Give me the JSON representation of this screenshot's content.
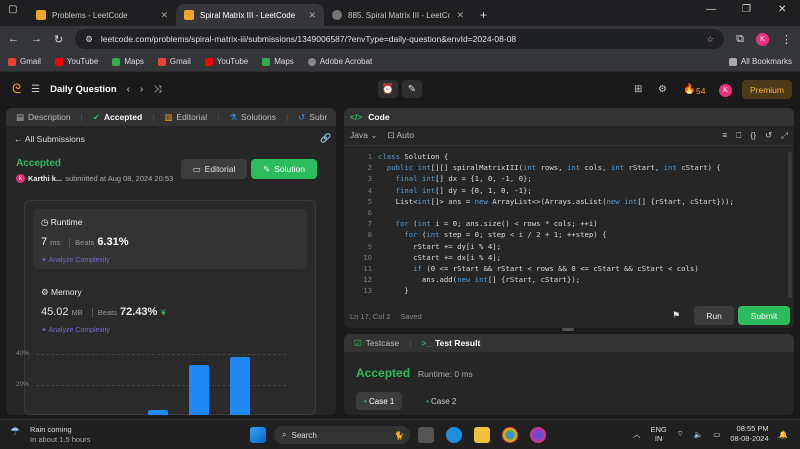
{
  "browser": {
    "tabs": [
      {
        "title": "Problems - LeetCode",
        "active": false
      },
      {
        "title": "Spiral Matrix III - LeetCode",
        "active": true
      },
      {
        "title": "885. Spiral Matrix III - LeetCod",
        "active": false
      }
    ],
    "new_tab": "+",
    "url": "leetcode.com/problems/spiral-matrix-iii/submissions/1349006587/?envType=daily-question&envId=2024-08-08",
    "profile_initial": "K",
    "bookmarks": [
      "Gmail",
      "YouTube",
      "Maps",
      "Gmail",
      "YouTube",
      "Maps",
      "Adobe Acrobat"
    ],
    "all_bookmarks": "All Bookmarks"
  },
  "lc_nav": {
    "title": "Daily Question",
    "streak": "54",
    "avatar": "K",
    "premium": "Premium"
  },
  "left_panel": {
    "tabs": [
      "Description",
      "Accepted",
      "Editorial",
      "Solutions",
      "Subr"
    ],
    "all_submissions": "All Submissions",
    "status": "Accepted",
    "user": "Karthi k...",
    "submitted": "submitted at Aug 08, 2024 20:53",
    "editorial_btn": "Editorial",
    "solution_btn": "Solution",
    "runtime": {
      "label": "Runtime",
      "value": "7",
      "unit": "ms",
      "beats_label": "Beats",
      "beats": "6.31%",
      "analyze": "Analyze Complexity"
    },
    "memory": {
      "label": "Memory",
      "value": "45.02",
      "unit": "MB",
      "beats_label": "Beats",
      "beats": "72.43%",
      "analyze": "Analyze Complexity"
    }
  },
  "chart_data": {
    "type": "bar",
    "yticks": [
      "40%",
      "20%"
    ],
    "ylim": [
      0,
      45
    ],
    "values": [
      4,
      33,
      38
    ]
  },
  "code_panel": {
    "title": "Code",
    "language": "Java",
    "mode": "Auto",
    "lines": [
      "class Solution {",
      "  public int[][] spiralMatrixIII(int rows, int cols, int rStart, int cStart) {",
      "    final int[] dx = {1, 0, -1, 0};",
      "    final int[] dy = {0, 1, 0, -1};",
      "    List<int[]> ans = new ArrayList<>(Arrays.asList(new int[] {rStart, cStart}));",
      "",
      "    for (int i = 0; ans.size() < rows * cols; ++i)",
      "      for (int step = 0; step < i / 2 + 1; ++step) {",
      "        rStart += dy[i % 4];",
      "        cStart += dx[i % 4];",
      "        if (0 <= rStart && rStart < rows && 0 <= cStart && cStart < cols)",
      "          ans.add(new int[] {rStart, cStart});",
      "      }"
    ],
    "cursor": "Ln 17, Col 2",
    "saved": "Saved",
    "run": "Run",
    "submit": "Submit"
  },
  "test_panel": {
    "tabs": [
      "Testcase",
      "Test Result"
    ],
    "status": "Accepted",
    "runtime": "Runtime: 0 ms",
    "cases": [
      "Case 1",
      "Case 2"
    ]
  },
  "taskbar": {
    "weather_title": "Rain coming",
    "weather_sub": "In about 1.5 hours",
    "search": "Search",
    "lang": "ENG",
    "region": "IN",
    "time": "08:55 PM",
    "date": "08-08-2024"
  }
}
